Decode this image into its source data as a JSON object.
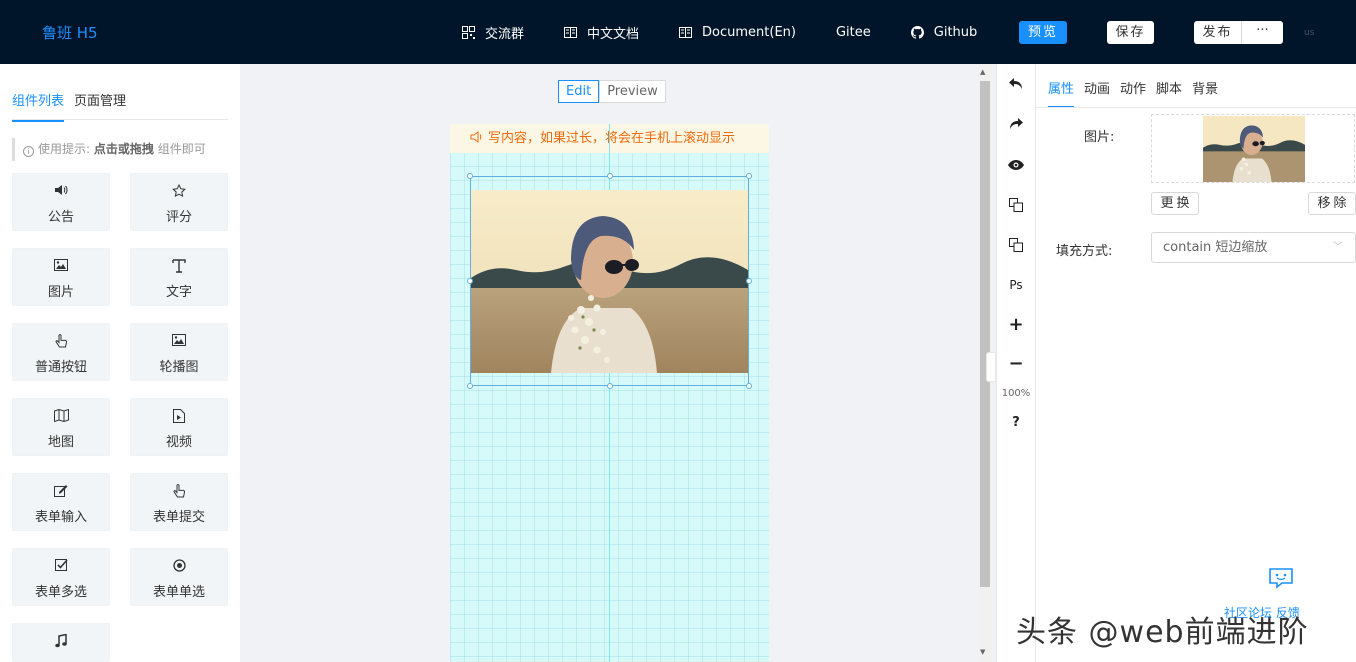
{
  "header": {
    "logo": "鲁班 H5",
    "nav": [
      {
        "label": "交流群",
        "icon": "qrcode-icon"
      },
      {
        "label": "中文文档",
        "icon": "book-icon"
      },
      {
        "label": "Document(En)",
        "icon": "book-icon"
      },
      {
        "label": "Gitee",
        "icon": ""
      },
      {
        "label": "Github",
        "icon": "github-icon"
      }
    ],
    "preview_label": "预览",
    "save_label": "保存",
    "publish_label": "发布",
    "more_label": "···",
    "tail_text": "us",
    "bg_color": "#001529",
    "accent_color": "#1890ff"
  },
  "left_panel": {
    "tabs": [
      {
        "label": "组件列表",
        "active": true
      },
      {
        "label": "页面管理",
        "active": false
      }
    ],
    "hint_prefix": "使用提示:",
    "hint_bold": "点击或拖拽",
    "hint_suffix": "组件即可",
    "components": [
      {
        "label": "公告",
        "icon": "speaker-icon"
      },
      {
        "label": "评分",
        "icon": "star-icon"
      },
      {
        "label": "图片",
        "icon": "picture-icon"
      },
      {
        "label": "文字",
        "icon": "text-icon"
      },
      {
        "label": "普通按钮",
        "icon": "pointer-icon"
      },
      {
        "label": "轮播图",
        "icon": "carousel-icon"
      },
      {
        "label": "地图",
        "icon": "map-icon"
      },
      {
        "label": "视频",
        "icon": "video-file-icon"
      },
      {
        "label": "表单输入",
        "icon": "edit-icon"
      },
      {
        "label": "表单提交",
        "icon": "pointer-icon"
      },
      {
        "label": "表单多选",
        "icon": "checkbox-icon"
      },
      {
        "label": "表单单选",
        "icon": "radio-icon"
      },
      {
        "label": "",
        "icon": "music-icon"
      }
    ]
  },
  "canvas": {
    "modes": [
      {
        "label": "Edit",
        "active": true
      },
      {
        "label": "Preview",
        "active": false
      }
    ],
    "notice_text": "写内容，如果过长，将会在手机上滚动显示"
  },
  "toolbar": {
    "tools": [
      "undo-icon",
      "redo-icon",
      "eye-icon",
      "copy-icon",
      "copy-icon",
      "ps-icon",
      "plus-icon",
      "minus-icon"
    ],
    "ps_label": "Ps",
    "zoom": "100%",
    "help_label": "?"
  },
  "right_panel": {
    "tabs": [
      {
        "label": "属性",
        "active": true
      },
      {
        "label": "动画",
        "active": false
      },
      {
        "label": "动作",
        "active": false
      },
      {
        "label": "脚本",
        "active": false
      },
      {
        "label": "背景",
        "active": false
      }
    ],
    "image_label": "图片:",
    "replace_label": "更换",
    "remove_label": "移除",
    "fill_label": "填充方式:",
    "fill_value": "contain 短边缩放",
    "feedback_text": "社区论坛 反馈"
  },
  "watermark": "头条 @web前端进阶"
}
